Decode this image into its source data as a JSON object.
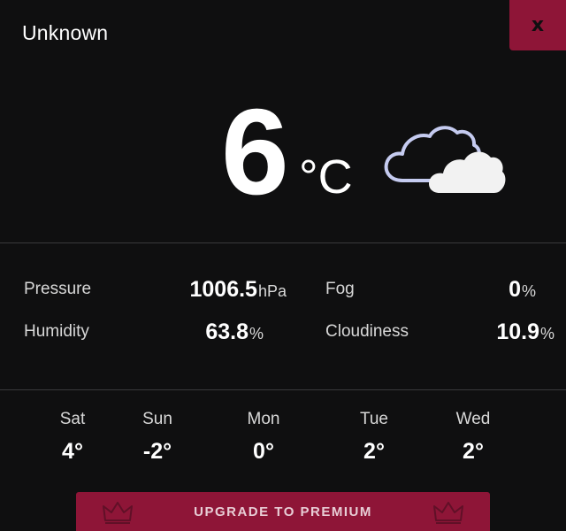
{
  "location": {
    "title": "Unknown"
  },
  "close_button": {
    "label": "x"
  },
  "current": {
    "temperature": "6",
    "unit": "°C",
    "icon": "cloudy-icon"
  },
  "stats": {
    "pressure": {
      "label": "Pressure",
      "value": "1006.5",
      "unit": "hPa"
    },
    "fog": {
      "label": "Fog",
      "value": "0",
      "unit": "%"
    },
    "humidity": {
      "label": "Humidity",
      "value": "63.8",
      "unit": "%"
    },
    "cloudiness": {
      "label": "Cloudiness",
      "value": "10.9",
      "unit": "%"
    }
  },
  "forecast": [
    {
      "day": "Sat",
      "temp": "4°"
    },
    {
      "day": "Sun",
      "temp": "-2°"
    },
    {
      "day": "Mon",
      "temp": "0°"
    },
    {
      "day": "Tue",
      "temp": "2°"
    },
    {
      "day": "Wed",
      "temp": "2°"
    }
  ],
  "upgrade": {
    "label": "UPGRADE TO PREMIUM",
    "icon": "crown-icon"
  },
  "colors": {
    "background": "#0f0f10",
    "accent": "#8e1537",
    "text": "#ffffff",
    "muted_text": "#d8d8d8"
  }
}
